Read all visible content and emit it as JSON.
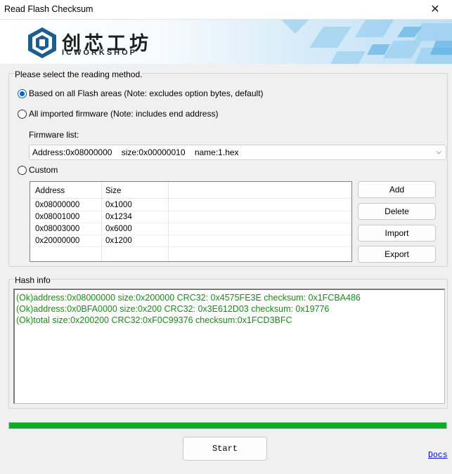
{
  "window": {
    "title": "Read Flash Checksum",
    "close_label": "✕"
  },
  "banner": {
    "logo_cn": "创芯工坊",
    "logo_en": "ICWORKSHOP"
  },
  "method": {
    "legend": "Please select the reading method.",
    "options": [
      {
        "label": "Based on all Flash areas (Note: excludes option bytes, default)",
        "selected": true
      },
      {
        "label": "All imported firmware (Note: includes end address)",
        "selected": false
      },
      {
        "label": "Custom",
        "selected": false
      }
    ],
    "firmware_list_label": "Firmware list:",
    "firmware_selected": "Address:0x08000000    size:0x00000010    name:1.hex"
  },
  "custom_table": {
    "columns": [
      "Address",
      "Size"
    ],
    "rows": [
      [
        "0x08000000",
        "0x1000"
      ],
      [
        "0x08001000",
        "0x1234"
      ],
      [
        "0x08003000",
        "0x6000"
      ],
      [
        "0x20000000",
        "0x1200"
      ]
    ]
  },
  "buttons": {
    "add": "Add",
    "delete": "Delete",
    "import": "Import",
    "export": "Export"
  },
  "hash": {
    "legend": "Hash info",
    "lines": [
      "(Ok)address:0x08000000 size:0x200000  CRC32: 0x4575FE3E  checksum: 0x1FCBA486",
      "(Ok)address:0x0BFA0000 size:0x200  CRC32: 0x3E612D03  checksum: 0x19776",
      "(Ok)total size:0x200200  CRC32:0xF0C99376  checksum:0x1FCD3BFC"
    ],
    "text_color": "#1a8a1a"
  },
  "progress": {
    "percent": 100,
    "color": "#06b025"
  },
  "footer": {
    "start_label": "Start",
    "docs_label": "Docs"
  }
}
